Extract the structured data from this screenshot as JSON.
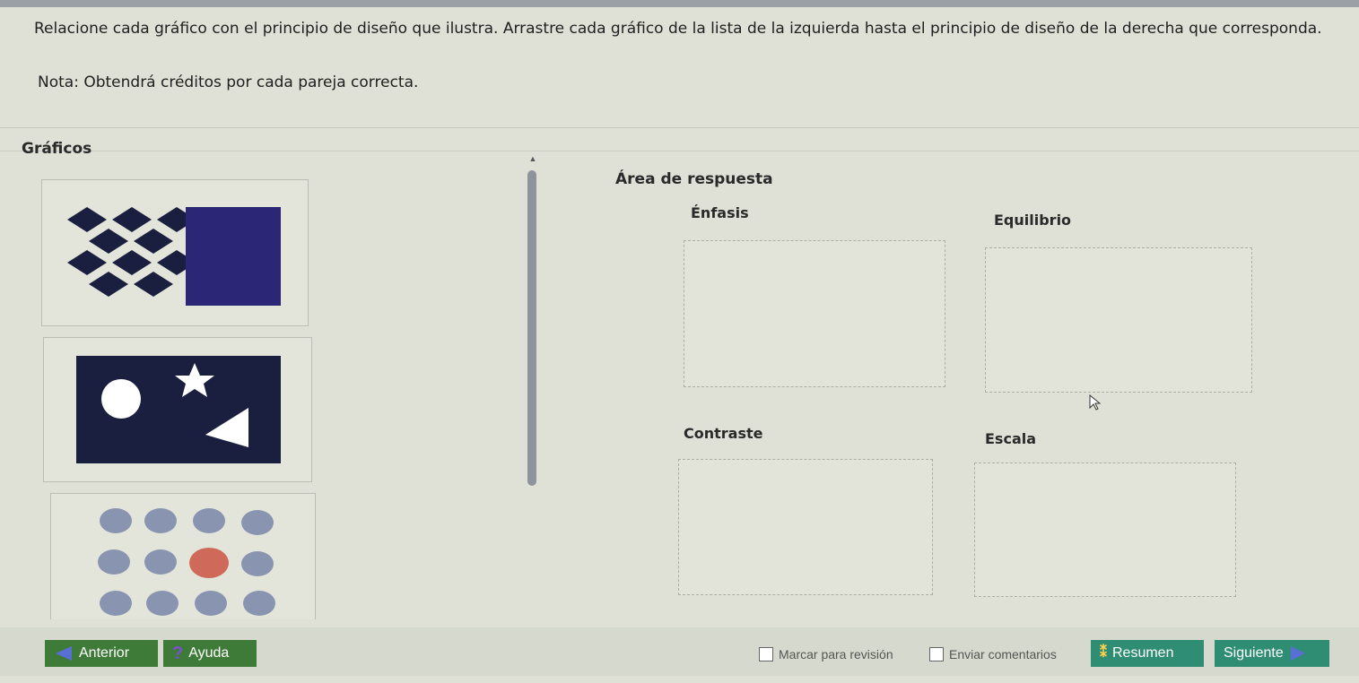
{
  "instructions": {
    "main": "Relacione cada gráfico con el principio de diseño que ilustra. Arrastre cada gráfico de la lista de la izquierda hasta el principio de diseño de la derecha que corresponda.",
    "note": "Nota: Obtendrá créditos por cada pareja correcta."
  },
  "graphics_panel": {
    "title": "Gráficos",
    "items": [
      {
        "icon": "diamond-grid-and-square-graphic"
      },
      {
        "icon": "circle-star-triangle-graphic"
      },
      {
        "icon": "dot-grid-highlight-graphic"
      }
    ]
  },
  "answer_area": {
    "title": "Área de respuesta",
    "zones": [
      {
        "label": "Énfasis"
      },
      {
        "label": "Equilibrio"
      },
      {
        "label": "Contraste"
      },
      {
        "label": "Escala"
      }
    ]
  },
  "footer": {
    "prev_label": "Anterior",
    "help_label": "Ayuda",
    "mark_review_label": "Marcar para revisión",
    "send_comments_label": "Enviar comentarios",
    "summary_label": "Resumen",
    "next_label": "Siguiente"
  },
  "colors": {
    "navy": "#1b1f3f",
    "purple_square": "#2c2676",
    "dot_blue": "#8995b0",
    "dot_red": "#cf6a5a",
    "button_green": "#3f7b38",
    "button_teal": "#2f8d73"
  }
}
